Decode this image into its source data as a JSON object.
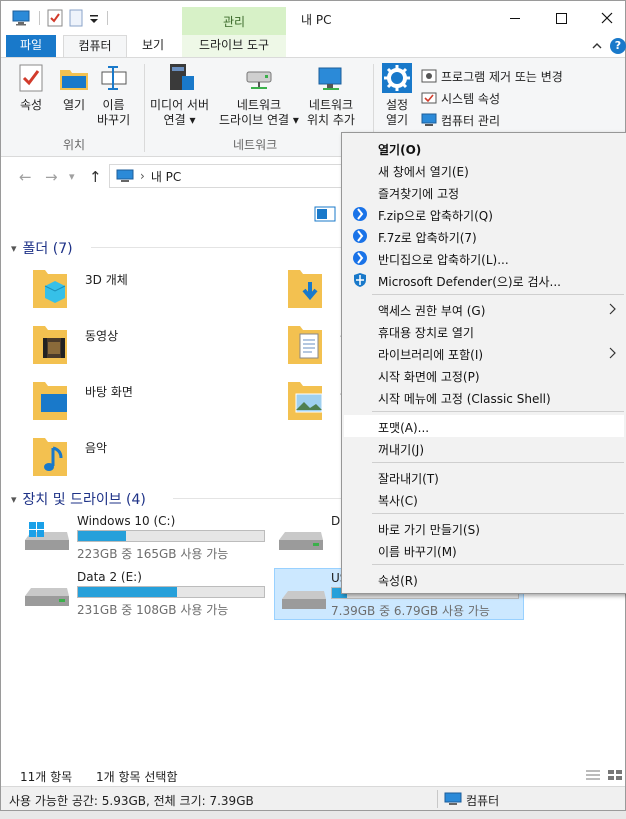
{
  "window": {
    "title": "내 PC",
    "context_tab_group": "관리"
  },
  "tabs": {
    "file": "파일",
    "computer": "컴퓨터",
    "view": "보기",
    "drive_tools": "드라이브 도구"
  },
  "ribbon": {
    "location": {
      "group_label": "위치",
      "properties": "속성",
      "open": "열기",
      "rename": "이름\n바꾸기"
    },
    "network": {
      "group_label": "네트워크",
      "media_server": "미디어 서버\n연결 ▾",
      "map_drive": "네트워크\n드라이브 연결 ▾",
      "add_location": "네트워크\n위치 추가"
    },
    "system": {
      "settings": "설정\n열기",
      "uninstall": "프로그램 제거 또는 변경",
      "system_props": "시스템 속성",
      "computer_mgmt": "컴퓨터 관리"
    }
  },
  "address": {
    "path": "내 PC"
  },
  "folders": {
    "header": "폴더 (7)",
    "items": [
      {
        "name": "3D 개체"
      },
      {
        "name": "다"
      },
      {
        "name": "동영상"
      },
      {
        "name": "문"
      },
      {
        "name": "바탕 화면"
      },
      {
        "name": "사"
      },
      {
        "name": "음악"
      }
    ]
  },
  "drives": {
    "header": "장치 및 드라이브 (4)",
    "items": [
      {
        "name": "Windows 10 (C:)",
        "free": "223GB 중 165GB 사용 가능",
        "used_fraction": 0.26
      },
      {
        "name": "Da",
        "free": "",
        "used_fraction": 0.5
      },
      {
        "name": "Data 2 (E:)",
        "free": "231GB 중 108GB 사용 가능",
        "used_fraction": 0.53
      },
      {
        "name": "US",
        "free": "7.39GB 중 6.79GB 사용 가능",
        "used_fraction": 0.08
      }
    ]
  },
  "status": {
    "item_count": "11개 항목",
    "selected": "1개 항목 선택함",
    "free_space": "사용 가능한 공간: 5.93GB, 전체 크기: 7.39GB",
    "location": "컴퓨터"
  },
  "context_menu": {
    "items": [
      {
        "label": "열기(O)",
        "bold": true
      },
      {
        "label": "새 창에서 열기(E)"
      },
      {
        "label": "즐겨찾기에 고정"
      },
      {
        "label": "F.zip으로 압축하기(Q)",
        "icon": "bandizip-icon"
      },
      {
        "label": "F.7z로 압축하기(7)",
        "icon": "bandizip-icon"
      },
      {
        "label": "반디집으로 압축하기(L)...",
        "icon": "bandizip-icon"
      },
      {
        "label": "Microsoft Defender(으)로 검사...",
        "icon": "defender-icon"
      },
      {
        "label": "액세스 권한 부여 (G)",
        "submenu": true
      },
      {
        "label": "휴대용 장치로 열기"
      },
      {
        "label": "라이브러리에 포함(I)",
        "submenu": true
      },
      {
        "label": "시작 화면에 고정(P)"
      },
      {
        "label": "시작 메뉴에 고정 (Classic Shell)"
      },
      {
        "label": "포맷(A)...",
        "highlighted": true
      },
      {
        "label": "꺼내기(J)"
      },
      {
        "label": "잘라내기(T)"
      },
      {
        "label": "복사(C)"
      },
      {
        "label": "바로 가기 만들기(S)"
      },
      {
        "label": "이름 바꾸기(M)"
      },
      {
        "label": "속성(R)"
      }
    ]
  },
  "colors": {
    "accent": "#1979ca",
    "drive_fill": "#26a0da",
    "manage_tab": "#d7f1c7",
    "selection": "#cce8ff"
  }
}
